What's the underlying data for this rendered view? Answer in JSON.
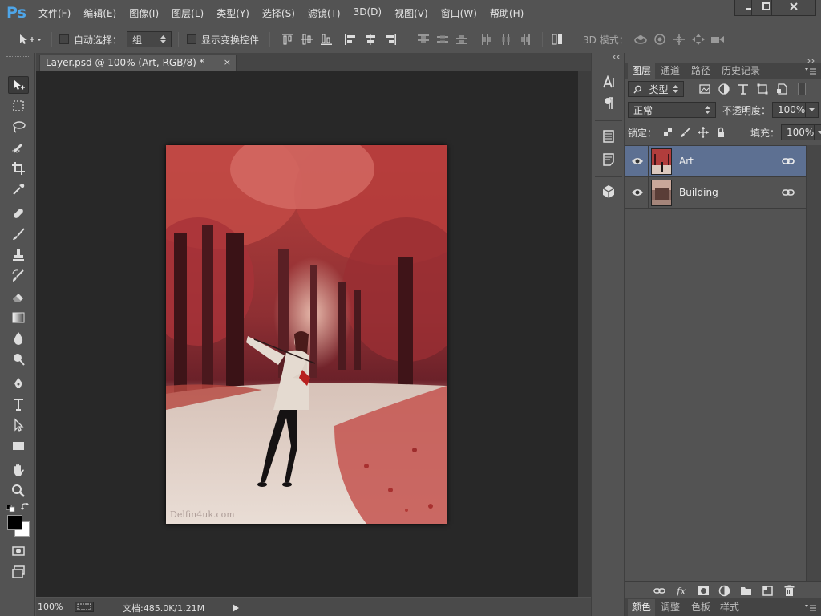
{
  "app": {
    "logo": "Ps",
    "menu": [
      "文件(F)",
      "编辑(E)",
      "图像(I)",
      "图层(L)",
      "类型(Y)",
      "选择(S)",
      "滤镜(T)",
      "3D(D)",
      "视图(V)",
      "窗口(W)",
      "帮助(H)"
    ],
    "window_buttons": [
      "minimize-icon",
      "maximize-icon",
      "close-icon"
    ]
  },
  "options": {
    "auto_select_label": "自动选择：",
    "auto_select_checked": false,
    "auto_select_value": "组",
    "transform_controls_label": "显示变换控件",
    "transform_controls_checked": false,
    "mode_3d_label": "3D 模式："
  },
  "tools": [
    "move-tool-icon",
    "marquee-tool-icon",
    "lasso-tool-icon",
    "quick-selection-tool-icon",
    "crop-tool-icon",
    "eyedropper-tool-icon",
    "healing-brush-tool-icon",
    "brush-tool-icon",
    "clone-stamp-tool-icon",
    "history-brush-tool-icon",
    "eraser-tool-icon",
    "gradient-tool-icon",
    "blur-tool-icon",
    "dodge-tool-icon",
    "pen-tool-icon",
    "type-tool-icon",
    "path-selection-tool-icon",
    "rectangle-tool-icon",
    "hand-tool-icon",
    "zoom-tool-icon"
  ],
  "colors": {
    "foreground": "#000000",
    "background": "#ffffff",
    "selected_layer": "#5d7092",
    "canvas_bg": "#282828",
    "ui_bg": "#535353"
  },
  "document": {
    "tab_title": "Layer.psd @ 100% (Art, RGB/8) *",
    "tab_close": "×",
    "zoom": "100%",
    "doc_info": "文档:485.0K/1.21M",
    "watermark": "Delfin4uk.com"
  },
  "panels": {
    "tabs": [
      "图层",
      "通道",
      "路径",
      "历史记录"
    ],
    "active_tab": "图层",
    "filter_kind": "类型",
    "blend_mode": "正常",
    "opacity_label": "不透明度：",
    "opacity_value": "100%",
    "lock_label": "锁定：",
    "fill_label": "填充：",
    "fill_value": "100%",
    "bottom_tabs": [
      "颜色",
      "调整",
      "色板",
      "样式"
    ]
  },
  "layers": [
    {
      "name": "Art",
      "visible": true,
      "selected": true,
      "linked": true
    },
    {
      "name": "Building",
      "visible": true,
      "selected": false,
      "linked": true
    }
  ]
}
